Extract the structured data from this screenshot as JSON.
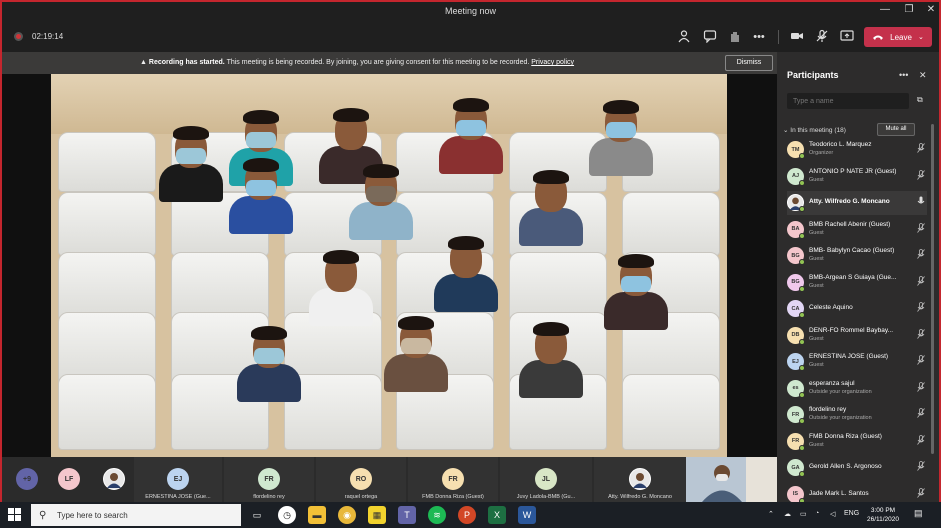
{
  "window": {
    "title": "Meeting now",
    "minimize": "—",
    "maximize": "❐",
    "close": "✕"
  },
  "toolbar": {
    "elapsed": "02:19:14",
    "leave_label": "Leave"
  },
  "banner": {
    "headline": "Recording has started.",
    "message": "This meeting is being recorded. By joining, you are giving consent for this meeting to be recorded.",
    "link": "Privacy policy",
    "dismiss_label": "Dismiss"
  },
  "filmstrip": [
    {
      "initials": "+9",
      "name": "",
      "color": "#6264a7"
    },
    {
      "initials": "LF",
      "name": "",
      "color": "#f4c6cc"
    },
    {
      "initials": "",
      "name": "",
      "color": "#e8e8e8",
      "photo": true
    },
    {
      "initials": "EJ",
      "name": "ERNESTINA JOSE (Gue...",
      "color": "#bcd4f0"
    },
    {
      "initials": "FR",
      "name": "flordelino rey",
      "color": "#cfe8cf"
    },
    {
      "initials": "RO",
      "name": "raquel ortega",
      "color": "#f6dfb0"
    },
    {
      "initials": "FR",
      "name": "FMB Donna Riza (Guest)",
      "color": "#f6dfb0"
    },
    {
      "initials": "JL",
      "name": "Juvy Ladola-BMB (Gu...",
      "color": "#d8e6c6"
    },
    {
      "initials": "",
      "name": "Atty. Wilfredo G. Moncano",
      "color": "#e8e8e8",
      "photo": true
    }
  ],
  "panel": {
    "title": "Participants",
    "search_placeholder": "Type a name",
    "in_meeting": "In this meeting (18)",
    "mute_all": "Mute all",
    "participants": [
      {
        "initials": "TM",
        "name": "Teodorico L. Marquez",
        "role": "Organizer",
        "color": "#f6dfb0",
        "status": "#92c353"
      },
      {
        "initials": "AJ",
        "name": "ANTONIO P NATE JR (Guest)",
        "role": "Guest",
        "color": "#cfe8cf",
        "status": "#92c353"
      },
      {
        "initials": "",
        "name": "Atty. Wilfredo G. Moncano",
        "role": "",
        "color": "#e8e8e8",
        "status": "#92c353",
        "photo": true
      },
      {
        "initials": "BA",
        "name": "BMB Rachell Abenir (Guest)",
        "role": "Guest",
        "color": "#f4c6cc",
        "status": "#92c353"
      },
      {
        "initials": "BG",
        "name": "BMB- Babylyn Cacao (Guest)",
        "role": "Guest",
        "color": "#f4c6cc",
        "status": "#92c353"
      },
      {
        "initials": "BG",
        "name": "BMB-Argean S Guiaya (Gue...",
        "role": "Guest",
        "color": "#f0c8ec",
        "status": "#92c353"
      },
      {
        "initials": "CA",
        "name": "Celeste Aquino",
        "role": "",
        "color": "#e2d6f5",
        "status": "#92c353"
      },
      {
        "initials": "DB",
        "name": "DENR-FO Rommel Baybay...",
        "role": "Guest",
        "color": "#f6dfb0",
        "status": "#92c353"
      },
      {
        "initials": "EJ",
        "name": "ERNESTINA JOSE (Guest)",
        "role": "Guest",
        "color": "#bcd4f0",
        "status": "#92c353"
      },
      {
        "initials": "es",
        "name": "esperanza sajul",
        "role": "Outside your organization",
        "color": "#cfe8cf",
        "status": "#92c353"
      },
      {
        "initials": "FR",
        "name": "flordelino rey",
        "role": "Outside your organization",
        "color": "#cfe8cf",
        "status": "#92c353"
      },
      {
        "initials": "FR",
        "name": "FMB Donna Riza (Guest)",
        "role": "Guest",
        "color": "#f6dfb0",
        "status": "#92c353"
      },
      {
        "initials": "GA",
        "name": "Gerold Allen S. Argonoso",
        "role": "",
        "color": "#cfe8cf",
        "status": "#92c353"
      },
      {
        "initials": "IS",
        "name": "Jade Mark L. Santos",
        "role": "",
        "color": "#f4c6cc",
        "status": "#92c353"
      }
    ]
  },
  "taskbar": {
    "search_placeholder": "Type here to search",
    "language": "ENG",
    "time": "3:00 PM",
    "date": "26/11/2020"
  }
}
